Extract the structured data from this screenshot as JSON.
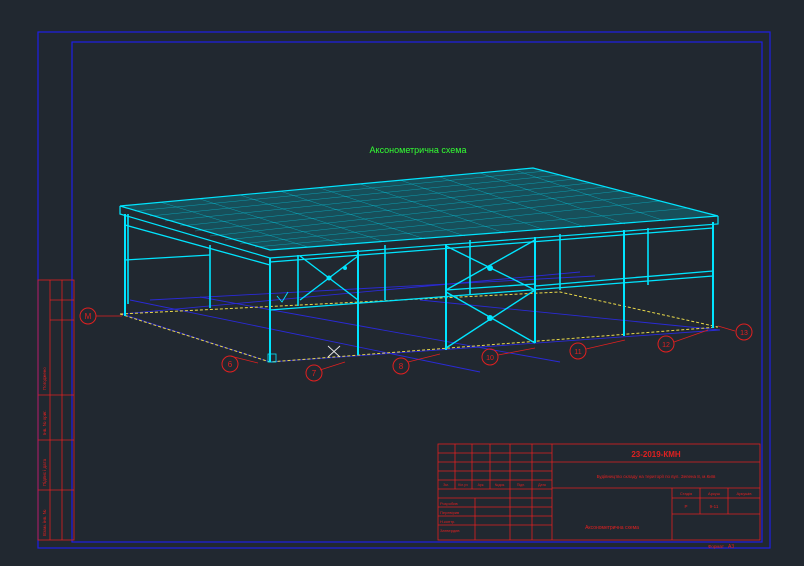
{
  "drawing": {
    "title": "Аксонометрична схема",
    "colors": {
      "background": "#212830",
      "frame": "#1e1ee6",
      "structure": "#00e5ff",
      "title": "#33ff33",
      "red": "#e02020",
      "dashed_outline": "#e8d84a"
    }
  },
  "axes": {
    "letter": [
      "М"
    ],
    "numbers": [
      "6",
      "7",
      "8",
      "10",
      "11",
      "12",
      "13"
    ]
  },
  "title_block": {
    "doc_code": "23-2019-КМН",
    "object_name": "Будівництво складу на території по вул. Зелена 8, м.Київ",
    "sheet_name": "Аксонометрична схема",
    "col_headers": [
      "Зм.",
      "Кіл.уч",
      "Арк.",
      "№док.",
      "Підп.",
      "Дата"
    ],
    "role_rows": [
      "Розробив",
      "Перевірив",
      "Н.контр.",
      "Затвердив"
    ],
    "stage_labels": [
      "Стадія",
      "Аркуш",
      "Аркушів"
    ],
    "stage_values": [
      "Р",
      "9-11",
      ""
    ],
    "format_label": "Формат",
    "format_value": "А3"
  },
  "side_stamp": {
    "labels": [
      "Погоджено",
      "Інв. № ориг.",
      "Підпис і дата",
      "Взам. інв. №"
    ]
  }
}
